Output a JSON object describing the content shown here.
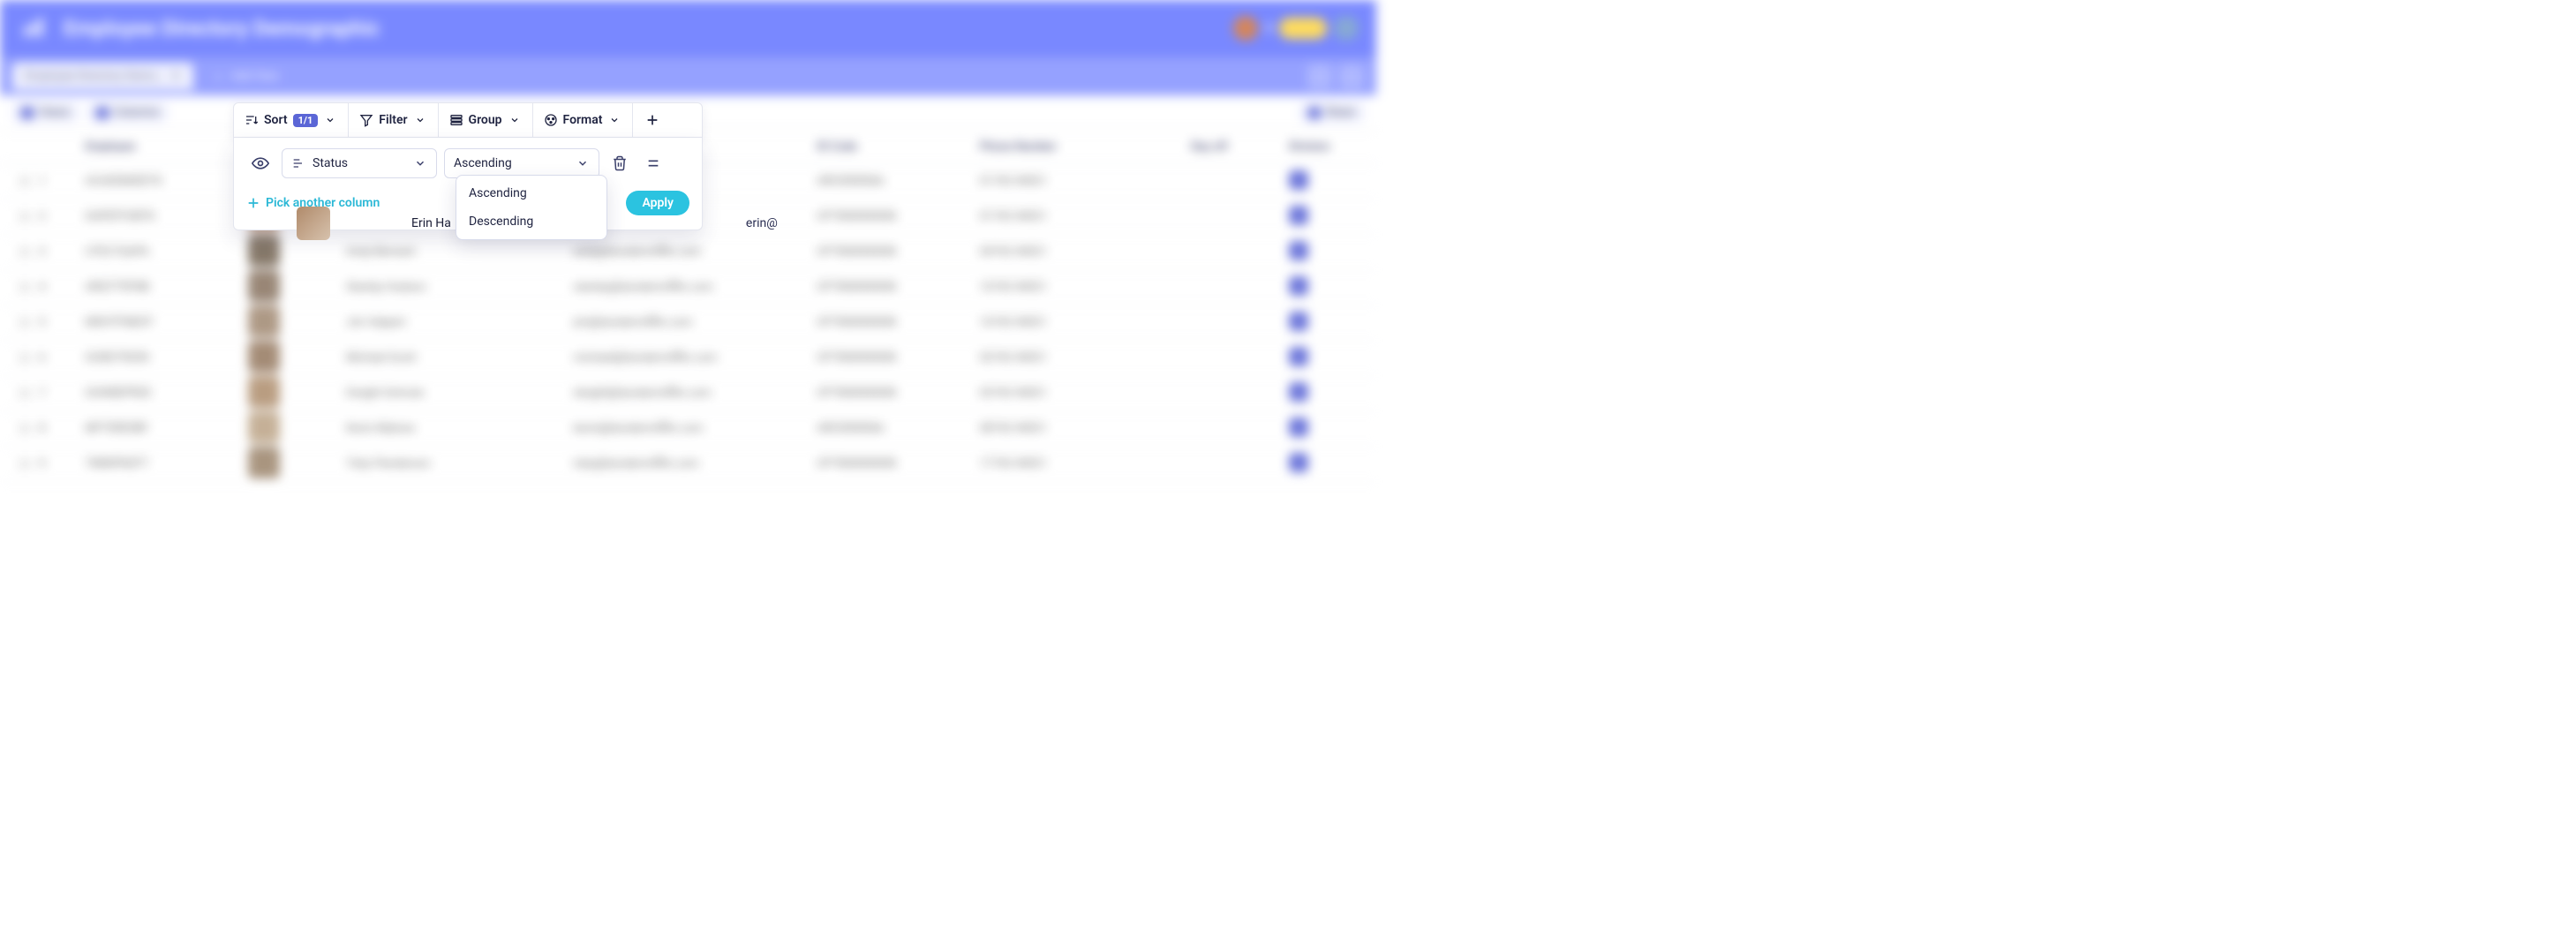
{
  "header": {
    "doc_title": "Employee Directory Demographic",
    "active_tab": "Employee Directory Demo…",
    "add_view_label": "Add View"
  },
  "view_toolbar": {
    "views_label": "Views",
    "columns_label": "Columns",
    "share_label": "Share"
  },
  "toolbar": {
    "sort_label": "Sort",
    "sort_badge": "1/1",
    "filter_label": "Filter",
    "group_label": "Group",
    "format_label": "Format"
  },
  "sort_panel": {
    "column_selected": "Status",
    "direction_selected": "Ascending",
    "direction_options": [
      "Ascending",
      "Descending"
    ],
    "pick_another": "Pick another column",
    "apply_label": "Apply"
  },
  "columns": {
    "employee": "Employee",
    "id_code": "ID Code",
    "phone": "Phone Number",
    "day_off": "Day off",
    "division": "Division"
  },
  "visible_row": {
    "name": "Erin Ha",
    "email_prefix": "erin@"
  },
  "blur_rows": [
    {
      "id": "ACADEMISET8",
      "name": "",
      "email": "",
      "code": "ARC0000066",
      "phone": "01742 04021"
    },
    {
      "id": "DAPEFFGBT8",
      "name": "Erin Hannon",
      "email": "erin@dundermifflin.com",
      "code": "OFT800000008",
      "phone": "01742 04021"
    },
    {
      "id": "UTEC7QAP6",
      "name": "Andy Bernard",
      "email": "andy@dundermifflin.com",
      "code": "OFT800000008",
      "phone": "04742 04021"
    },
    {
      "id": "ARQTT9FNB",
      "name": "Stanley Hudson",
      "email": "stanley@dundermifflin.com",
      "code": "OFT800000008",
      "phone": "16742 04021"
    },
    {
      "id": "MSHTFN8CP",
      "name": "Jim Halpert",
      "email": "jim@dundermifflin.com",
      "code": "OFT800000008",
      "phone": "16742 04021"
    },
    {
      "id": "GO8D7902N",
      "name": "Michael Scott",
      "email": "michael@dundermifflin.com",
      "code": "OFT800000008",
      "phone": "02742 04021"
    },
    {
      "id": "GOW8EPR2E",
      "name": "Dwight Schrute",
      "email": "dwight@dundermifflin.com",
      "code": "OFT800000008",
      "phone": "02742 04021"
    },
    {
      "id": "MFTERE5BF",
      "name": "Kevin Malone",
      "email": "kevin@dundermifflin.com",
      "code": "ARC0000066",
      "phone": "08742 04021"
    },
    {
      "id": "TMNIPN2FT",
      "name": "Toby Flenderson",
      "email": "toby@dundermifflin.com",
      "code": "OFT800000008",
      "phone": "17742 04021"
    }
  ],
  "thumb_colors": [
    "#b78a56",
    "#c8a184",
    "#7a6b5a",
    "#8e7a68",
    "#a58e78",
    "#9b8068",
    "#b29374",
    "#bfa88c",
    "#a08a72"
  ]
}
